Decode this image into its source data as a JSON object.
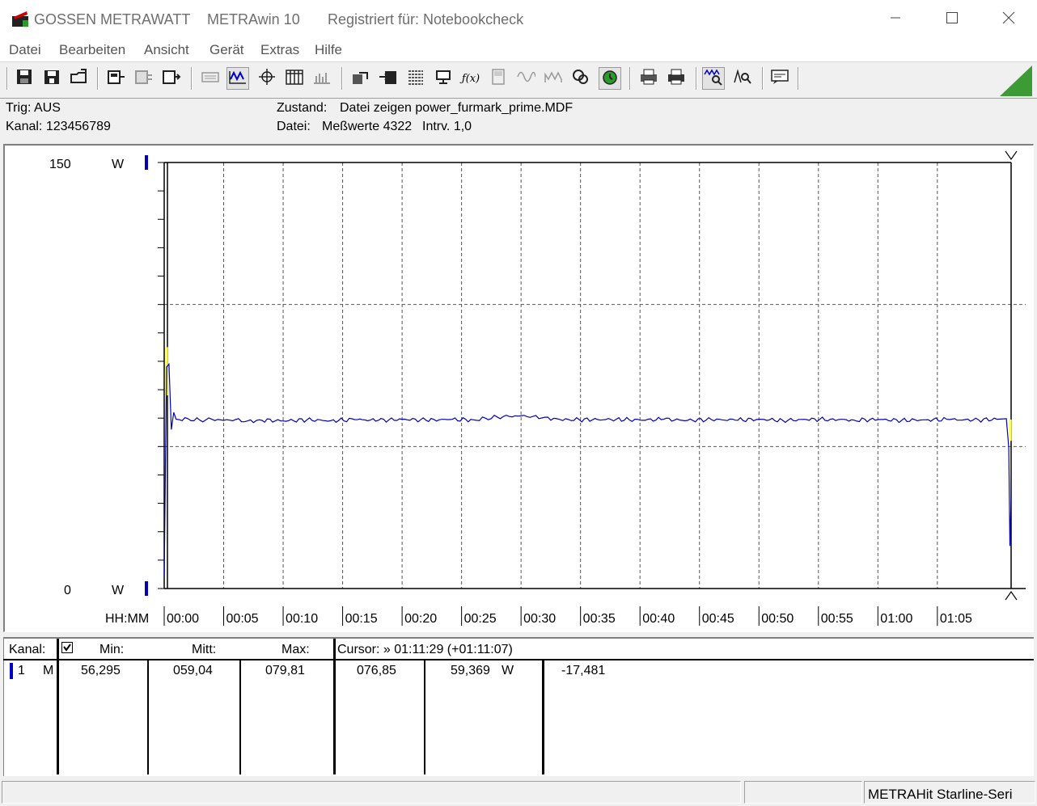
{
  "title_bar": {
    "brand": "GOSSEN METRAWATT",
    "app": "METRAwin 10",
    "registered": "Registriert für: Notebookcheck"
  },
  "menu": [
    "Datei",
    "Bearbeiten",
    "Ansicht",
    "Gerät",
    "Extras",
    "Hilfe"
  ],
  "toolbar_icons": [
    "save-icon",
    "save-as-icon",
    "open-folder-icon",
    "device-in-icon",
    "device-disabled-icon",
    "device-out-icon",
    "keyboard-icon",
    "waveform-view-icon",
    "crosshair-icon",
    "table-view-icon",
    "bars-view-icon",
    "export-icon",
    "transfer-icon",
    "list-icon",
    "monitor-icon",
    "function-icon",
    "meter-icon",
    "sine-icon",
    "wave-icon",
    "link-icon",
    "clock-icon",
    "print-preview-icon",
    "print-icon",
    "zoom-wave-icon",
    "zoom-cursor-icon",
    "display-icon"
  ],
  "info": {
    "trig": "Trig: AUS",
    "kanal": "Kanal: 123456789",
    "zustand_label": "Zustand:",
    "zustand_value": "Datei zeigen power_furmark_prime.MDF",
    "datei_label": "Datei:",
    "messwerte": "Meßwerte 4322",
    "intrv": "Intrv. 1,0"
  },
  "chart_data": {
    "type": "line",
    "y_top_label": "150",
    "y_bottom_label": "0",
    "y_unit": "W",
    "ylim": [
      0,
      150
    ],
    "x_axis_label": "HH:MM",
    "x_ticks": [
      "00:00",
      "00:05",
      "00:10",
      "00:15",
      "00:20",
      "00:25",
      "00:30",
      "00:35",
      "00:40",
      "00:45",
      "00:50",
      "00:55",
      "01:00",
      "01:05"
    ],
    "xlim_minutes": [
      0,
      71.2
    ],
    "grid": "dashed",
    "series": [
      {
        "color": "#0000c0",
        "x_minutes": [
          0,
          0.2,
          0.4,
          0.6,
          0.8,
          1,
          2,
          3,
          4,
          5,
          6,
          7,
          8,
          10,
          12,
          14,
          16,
          18,
          20,
          22,
          24,
          26,
          27,
          28,
          29,
          30,
          31,
          32,
          33,
          34,
          36,
          38,
          40,
          42,
          44,
          46,
          48,
          50,
          52,
          54,
          56,
          58,
          60,
          62,
          64,
          66,
          68,
          70,
          70.8,
          71.0,
          71.1,
          71.2
        ],
        "values": [
          4,
          78,
          79,
          56,
          62,
          59.6,
          59.8,
          59.3,
          59.6,
          59.2,
          59.5,
          59.0,
          59.4,
          59.0,
          59.4,
          59.1,
          59.5,
          59.2,
          59.6,
          59.3,
          59.5,
          59.4,
          60.0,
          60.4,
          60.6,
          60.8,
          60.6,
          60.3,
          59.8,
          59.5,
          59.4,
          59.6,
          59.3,
          59.6,
          59.2,
          59.5,
          59.3,
          59.6,
          59.2,
          59.5,
          59.6,
          59.3,
          59.5,
          59.2,
          59.4,
          59.5,
          59.3,
          59.6,
          59.8,
          49.5,
          15,
          32
        ]
      }
    ]
  },
  "table": {
    "headers": {
      "kanal": "Kanal:",
      "min": "Min:",
      "mitt": "Mitt:",
      "max": "Max:",
      "cursor": "Cursor: » 01:11:29 (+01:11:07)"
    },
    "row": {
      "channel": "1",
      "mode": "M",
      "min": "56,295",
      "mitt": "059,04",
      "max": "079,81",
      "cursor1": "076,85",
      "cursor2": "59,369",
      "unit": "W",
      "diff": "-17,481"
    }
  },
  "status": {
    "device": "METRAHit Starline-Seri"
  }
}
